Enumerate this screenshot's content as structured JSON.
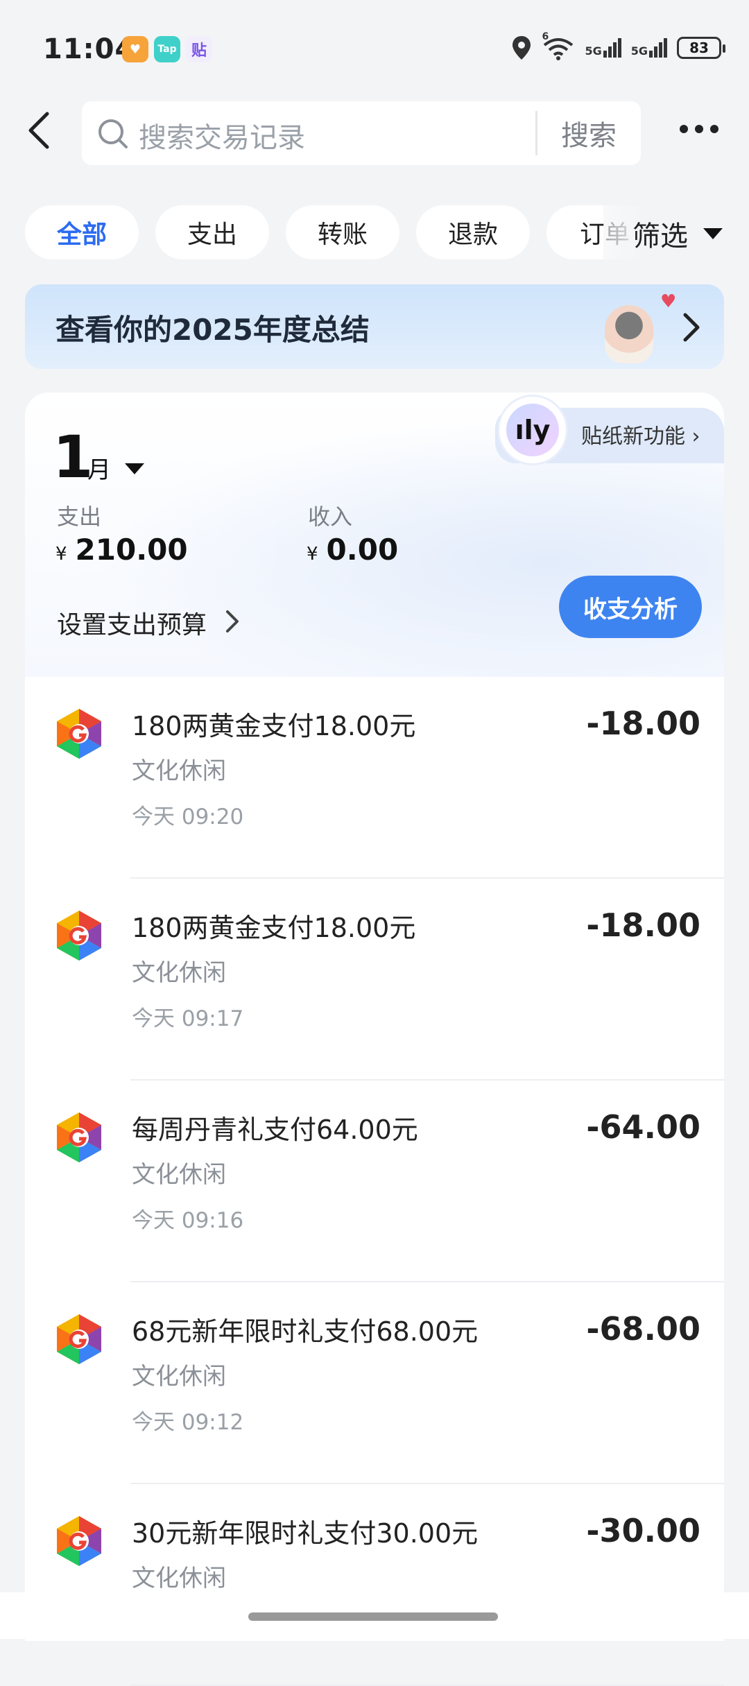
{
  "status_bar": {
    "time": "11:04",
    "apps": [
      {
        "name": "heart-app-icon",
        "glyph": "♥",
        "color": "#f6a33a"
      },
      {
        "name": "taptap-app-icon",
        "glyph": "Tap",
        "color": "#3fd0c9"
      },
      {
        "name": "tie-app-icon",
        "glyph": "贴",
        "color": "#7a56e6"
      }
    ],
    "signal_1": "5G",
    "signal_2": "5G",
    "wifi_label": "6",
    "battery": "83"
  },
  "header": {
    "search_placeholder": "搜索交易记录",
    "search_button": "搜索"
  },
  "filters": {
    "chips": [
      "全部",
      "支出",
      "转账",
      "退款",
      "订单"
    ],
    "active_index": 0,
    "filter_label": "筛选"
  },
  "banner": {
    "title": "查看你的2025年度总结"
  },
  "summary": {
    "sticker_feature": "贴纸新功能",
    "month_num": "1",
    "month_unit": "月",
    "expense_label": "支出",
    "expense_value": "210.00",
    "income_label": "收入",
    "income_value": "0.00",
    "currency": "¥",
    "budget_label": "设置支出预算",
    "analysis_button": "收支分析"
  },
  "transactions": [
    {
      "title": "180两黄金支付18.00元",
      "category": "文化休闲",
      "time": "今天 09:20",
      "amount": "-18.00"
    },
    {
      "title": "180两黄金支付18.00元",
      "category": "文化休闲",
      "time": "今天 09:17",
      "amount": "-18.00"
    },
    {
      "title": "每周丹青礼支付64.00元",
      "category": "文化休闲",
      "time": "今天 09:16",
      "amount": "-64.00"
    },
    {
      "title": "68元新年限时礼支付68.00元",
      "category": "文化休闲",
      "time": "今天 09:12",
      "amount": "-68.00"
    },
    {
      "title": "30元新年限时礼支付30.00元",
      "category": "文化休闲",
      "time": "",
      "amount": "-30.00"
    }
  ]
}
